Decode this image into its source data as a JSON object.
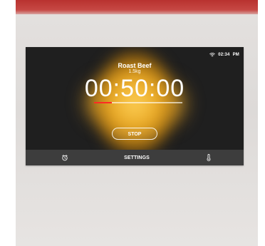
{
  "status": {
    "time": "02:34",
    "meridiem": "PM"
  },
  "recipe": {
    "title": "Roast Beef",
    "weight": "1.5kg"
  },
  "timer": {
    "remaining": "00:50:00",
    "progress": 0.2
  },
  "buttons": {
    "stop_label": "STOP"
  },
  "bottom_bar": {
    "settings_label": "SETTINGS"
  },
  "icons": {
    "wifi": "wifi-icon",
    "timer": "timer-icon",
    "temperature": "thermometer-icon"
  },
  "colors": {
    "accent": "#ff2b24",
    "screen_background": "#1f1f1f",
    "bottom_bar": "#3d3d3d",
    "glow": "#f0b12a"
  }
}
